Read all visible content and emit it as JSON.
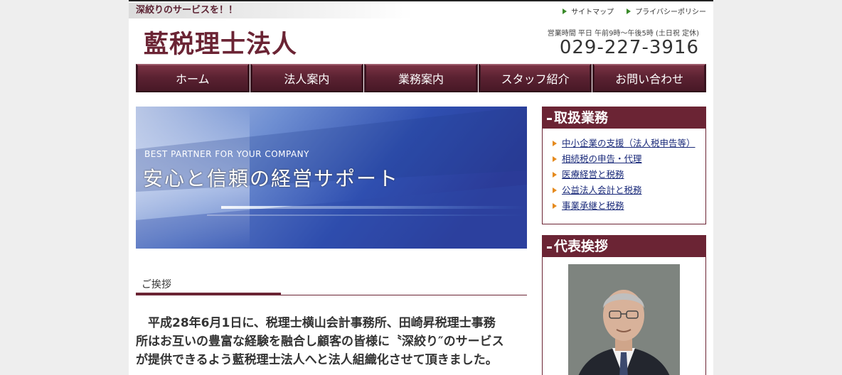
{
  "header": {
    "tagline": "深絞りのサービスを！！",
    "links": [
      "サイトマップ",
      "プライバシーポリシー"
    ],
    "brand": "藍税理士法人",
    "hours": "営業時間 平日 午前9時～午後5時 (土日祝 定休)",
    "phone": "029-227-3916"
  },
  "nav": [
    "ホーム",
    "法人案内",
    "業務案内",
    "スタッフ紹介",
    "お問い合わせ"
  ],
  "hero": {
    "subtitle": "BEST PARTNER FOR YOUR COMPANY",
    "title": "安心と信頼の経営サポート"
  },
  "greeting": {
    "heading": "ご挨拶",
    "text": "　平成28年6月1日に、税理士横山会計事務所、田崎昇税理士事務所はお互いの豊富な経験を融合し顧客の皆様に〝深絞り″のサービスが提供できるよう藍税理士法人へと法人組織化させて頂きました。"
  },
  "sidebar": {
    "services_title": "取扱業務",
    "services": [
      "中小企業の支援（法人税申告等）",
      "相続税の申告・代理",
      "医療経営と税務",
      "公益法人会計と税務",
      "事業承継と税務"
    ],
    "greeting_title": "代表挨拶"
  },
  "colors": {
    "brand": "#6b2434",
    "link": "#1a2a7a",
    "bullet": "#e58a1e"
  }
}
